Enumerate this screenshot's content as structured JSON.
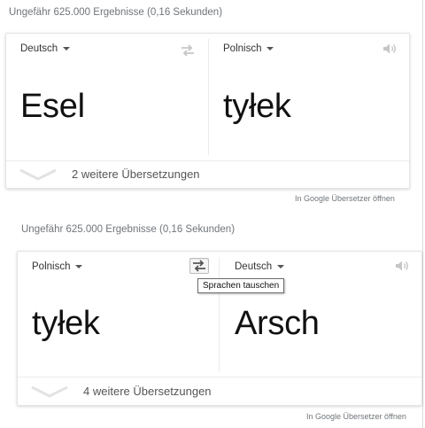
{
  "panels": [
    {
      "stats": "Ungefähr 625.000 Ergebnisse (0,16 Sekunden)",
      "source_lang": "Deutsch",
      "target_lang": "Polnisch",
      "source_text": "Esel",
      "target_text": "tyłek",
      "more_translations": "2 weitere Übersetzungen",
      "open_link": "In Google Übersetzer öffnen"
    },
    {
      "stats": "Ungefähr 625.000 Ergebnisse (0,16 Sekunden)",
      "source_lang": "Polnisch",
      "target_lang": "Deutsch",
      "source_text": "tyłek",
      "target_text": "Arsch",
      "more_translations": "4 weitere Übersetzungen",
      "open_link": "In Google Übersetzer öffnen",
      "swap_tooltip": "Sprachen tauschen"
    }
  ],
  "icons": {
    "swap": "swap-arrows-icon",
    "speaker": "speaker-icon",
    "expand": "chevron-down-icon",
    "caret": "caret-down-icon"
  },
  "colors": {
    "muted_text": "#70757a",
    "divider": "#ececec",
    "icon_gray": "#c6c6c6"
  }
}
